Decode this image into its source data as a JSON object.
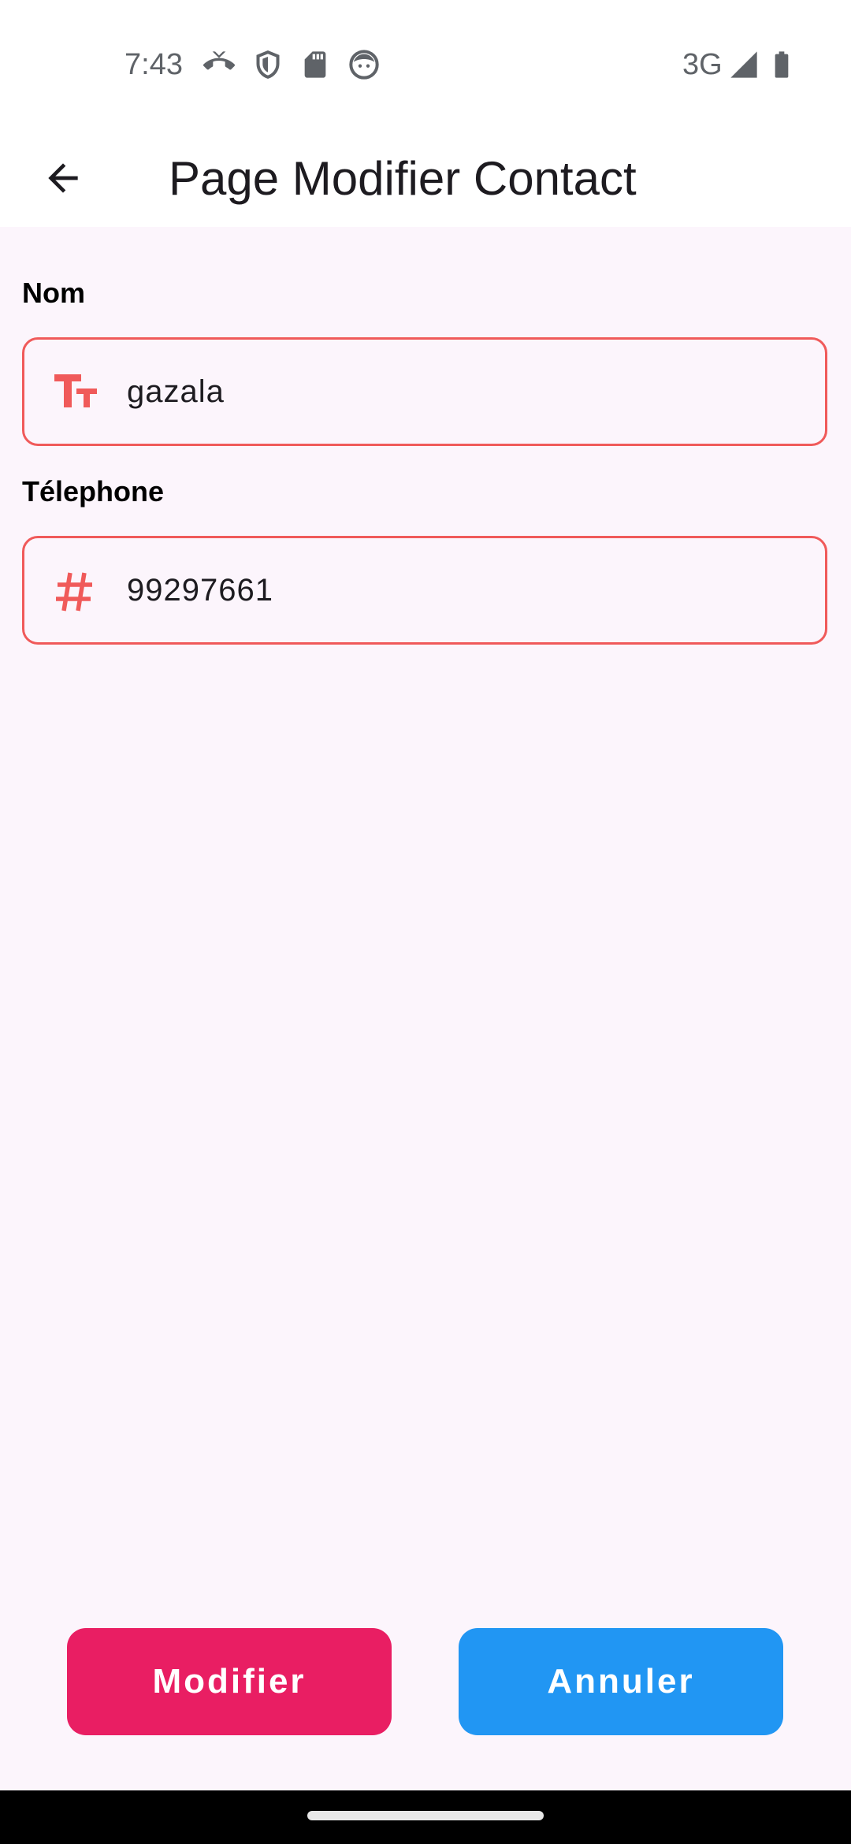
{
  "status_bar": {
    "time": "7:43",
    "network": "3G",
    "icons": [
      "missed-call-icon",
      "shield-icon",
      "sd-card-icon",
      "face-icon",
      "signal-icon",
      "battery-icon"
    ]
  },
  "app_bar": {
    "back_icon": "arrow-back-icon",
    "title": "Page Modifier Contact"
  },
  "form": {
    "name": {
      "label": "Nom",
      "icon": "text-fields-icon",
      "value": "gazala"
    },
    "phone": {
      "label": "Télephone",
      "icon": "hash-icon",
      "value": "99297661"
    }
  },
  "actions": {
    "modify_label": "Modifier",
    "cancel_label": "Annuler"
  },
  "colors": {
    "accent_red": "#f05a5a",
    "modify_button": "#e91e63",
    "cancel_button": "#2196f3",
    "background": "#fcf5fc"
  }
}
